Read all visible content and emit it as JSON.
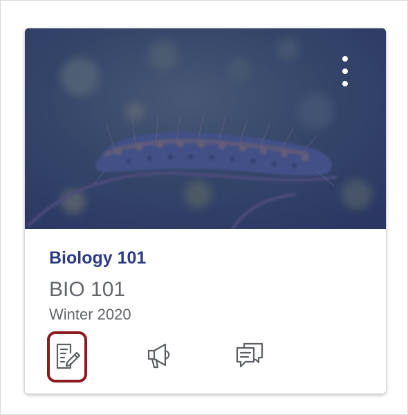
{
  "card": {
    "course_name": "Biology 101",
    "course_code": "BIO 101",
    "term": "Winter 2020",
    "image_subject": "caterpillar-image",
    "overlay_color": "#2d3b82"
  },
  "menu": {
    "icon": "more-options-icon"
  },
  "actions": [
    {
      "name": "assignments",
      "icon": "assignments-icon",
      "highlighted": true
    },
    {
      "name": "announcements",
      "icon": "announcements-icon",
      "highlighted": false
    },
    {
      "name": "discussions",
      "icon": "discussions-icon",
      "highlighted": false
    }
  ],
  "colors": {
    "course_name": "#2d3b82",
    "text_muted": "#62666a",
    "highlight": "#8a1b20"
  }
}
